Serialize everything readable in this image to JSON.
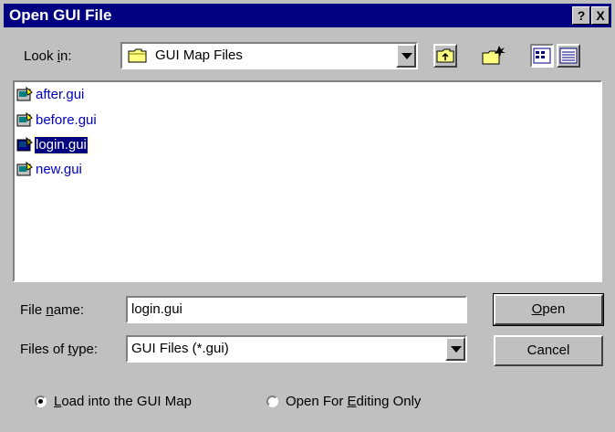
{
  "window": {
    "title": "Open GUI File",
    "help_glyph": "?",
    "close_glyph": "X"
  },
  "look_in": {
    "label_pre": "Look ",
    "label_key": "i",
    "label_post": "n:",
    "value": "GUI Map Files"
  },
  "files": [
    {
      "name": "after.gui",
      "selected": false
    },
    {
      "name": "before.gui",
      "selected": false
    },
    {
      "name": "login.gui",
      "selected": true
    },
    {
      "name": "new.gui",
      "selected": false
    }
  ],
  "file_name": {
    "label_pre": "File ",
    "label_key": "n",
    "label_post": "ame:",
    "value": "login.gui"
  },
  "file_type": {
    "label_pre": "Files of ",
    "label_key": "t",
    "label_post": "ype:",
    "value": "GUI Files (*.gui)"
  },
  "buttons": {
    "open_key": "O",
    "open_rest": "pen",
    "cancel": "Cancel"
  },
  "options": {
    "load_key": "L",
    "load_rest": "oad into the GUI Map",
    "edit_pre": "Open For ",
    "edit_key": "E",
    "edit_rest": "diting Only",
    "selected": "load"
  },
  "colors": {
    "title_bar": "#000080",
    "face": "#c0c0c0",
    "file_text": "#0000c0"
  }
}
